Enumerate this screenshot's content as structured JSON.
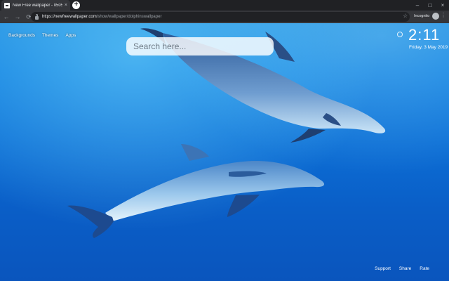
{
  "browser": {
    "tab": {
      "title": "New Free wallpaper - 0505200...",
      "close": "×"
    },
    "new_tab": "+",
    "window_controls": [
      "–",
      "□",
      "×"
    ],
    "nav": {
      "back": "←",
      "forward": "→",
      "reload": "⟳"
    },
    "url": {
      "host": "https://newfreewallpaper.com",
      "path": "/show/wallpaper/dolphinswallpaper"
    },
    "bookmark_star": "☆",
    "profile_label": "Incognito",
    "menu": "⋮"
  },
  "page": {
    "top_links": [
      "Backgrounds",
      "Themes",
      "Apps"
    ],
    "search": {
      "placeholder": "Search here..."
    },
    "clock": {
      "time": "2:11",
      "date": "Friday, 3 May 2019"
    },
    "bottom_links": [
      "Support",
      "Share",
      "Rate"
    ],
    "background_colors": {
      "water_top": "#1c8ae0",
      "water_bottom": "#0a55bd"
    }
  }
}
